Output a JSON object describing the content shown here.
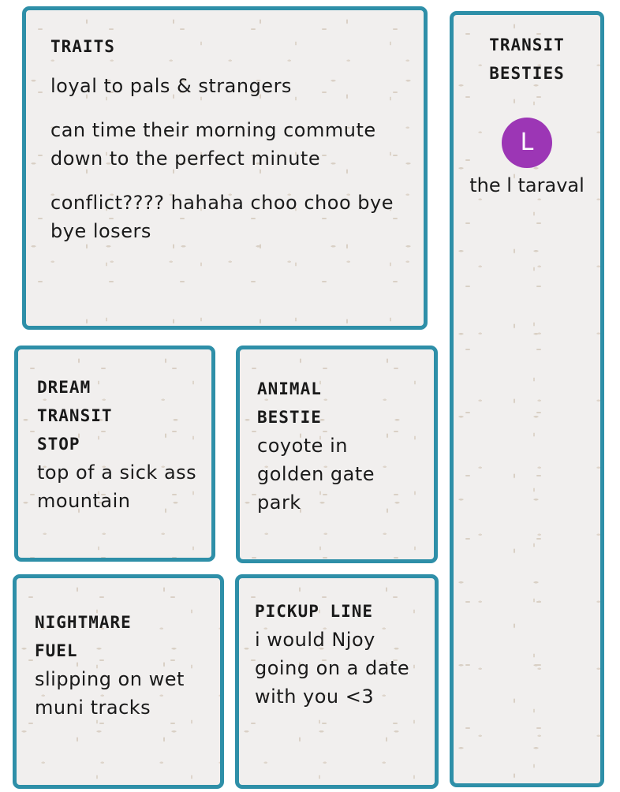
{
  "traits": {
    "heading": "TRAITS",
    "items": [
      "loyal to pals & strangers",
      "can time their morning commute down to the perfect minute",
      "conflict???? hahaha choo choo bye bye losers"
    ]
  },
  "transit_besties": {
    "heading_line1": "TRANSIT",
    "heading_line2": "BESTIES",
    "items": [
      {
        "badge": "L",
        "name": "the l taraval",
        "badge_color": "#9c36b5"
      }
    ]
  },
  "dream_stop": {
    "heading_line1": "DREAM",
    "heading_line2": "TRANSIT",
    "heading_line3": "STOP",
    "text": "top of a sick ass mountain"
  },
  "animal_bestie": {
    "heading_line1": "ANIMAL",
    "heading_line2": "BESTIE",
    "text": "coyote in golden gate park"
  },
  "nightmare_fuel": {
    "heading_line1": "NIGHTMARE",
    "heading_line2": "FUEL",
    "text": "slipping on wet muni tracks"
  },
  "pickup_line": {
    "heading": "PICKUP LINE",
    "text": "i would Njoy going on a date with you <3"
  },
  "colors": {
    "card_border": "#2e8fa8",
    "card_background": "#f1efee"
  }
}
